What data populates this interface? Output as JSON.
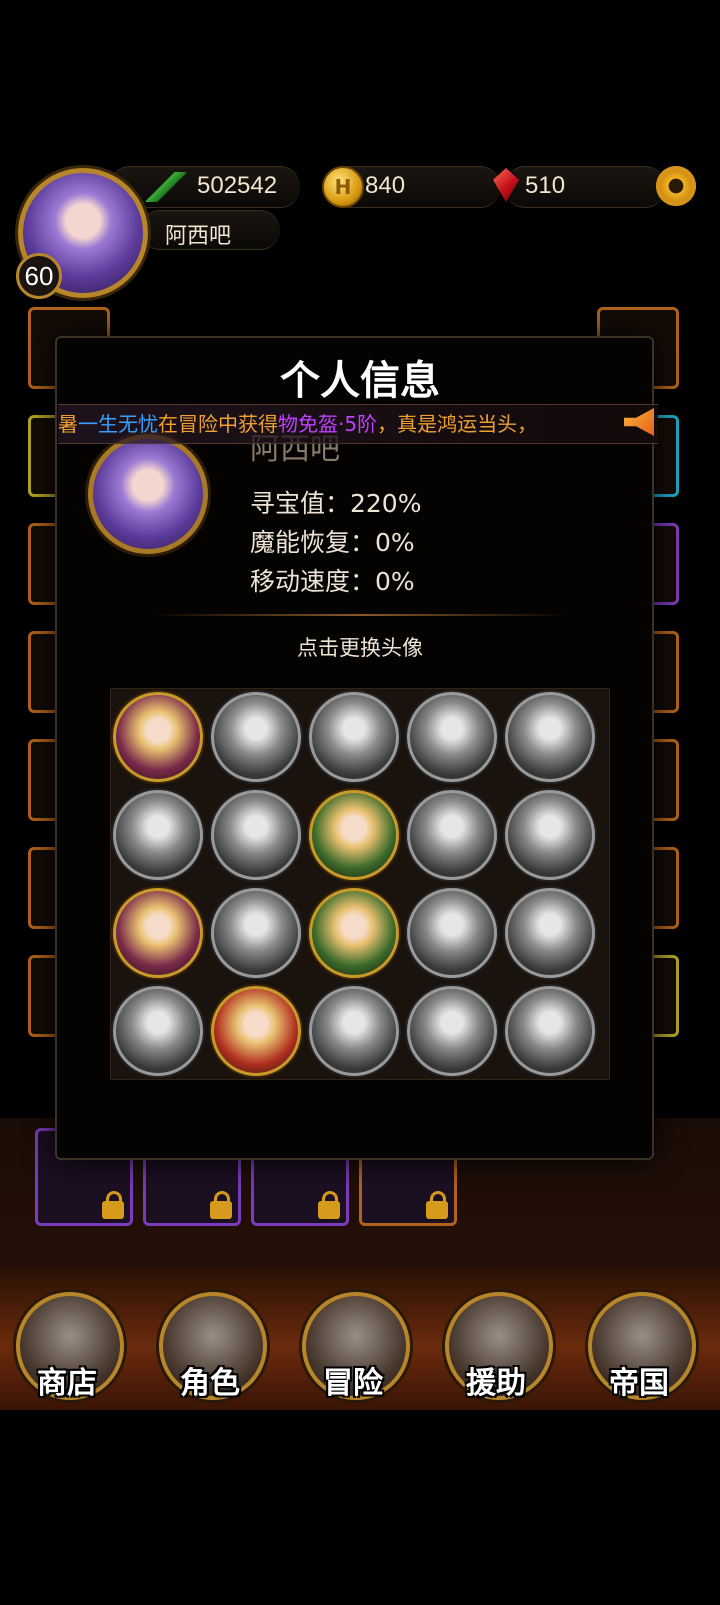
{
  "hud": {
    "power": "502542",
    "gold": "840",
    "gems": "510",
    "player_name": "阿西吧",
    "level": "60",
    "icons": {
      "power": "green-sword-icon",
      "gold": "gold-coin-icon",
      "gems": "red-gem-icon",
      "settings": "gear-icon"
    }
  },
  "modal": {
    "title": "个人信息",
    "ticker": [
      {
        "text": "暑",
        "color": "#f0a030"
      },
      {
        "text": "一生无忧",
        "color": "#3aa0ff"
      },
      {
        "text": "在冒险中获得",
        "color": "#f0a030"
      },
      {
        "text": "物免盔·5阶",
        "color": "#c040ff"
      },
      {
        "text": "，真是鸿运当头，",
        "color": "#f0a030"
      }
    ],
    "name": "阿西吧",
    "stats": [
      "寻宝值：220%",
      "魔能恢复：0%",
      "移动速度：0%"
    ],
    "hint": "点击更换头像",
    "avatars": [
      {
        "unlocked": true
      },
      {
        "unlocked": false
      },
      {
        "unlocked": false
      },
      {
        "unlocked": false
      },
      {
        "unlocked": false
      },
      {
        "unlocked": false
      },
      {
        "unlocked": false
      },
      {
        "unlocked": true
      },
      {
        "unlocked": false
      },
      {
        "unlocked": false
      },
      {
        "unlocked": true
      },
      {
        "unlocked": false
      },
      {
        "unlocked": true
      },
      {
        "unlocked": false
      },
      {
        "unlocked": false
      },
      {
        "unlocked": false
      },
      {
        "unlocked": true
      },
      {
        "unlocked": false
      },
      {
        "unlocked": false
      },
      {
        "unlocked": false
      }
    ]
  },
  "nav": [
    {
      "label": "商店",
      "icon": "castle-icon"
    },
    {
      "label": "角色",
      "icon": "hooded-figure-icon"
    },
    {
      "label": "冒险",
      "icon": "dungeon-gate-icon"
    },
    {
      "label": "援助",
      "icon": "heroine-icon"
    },
    {
      "label": "帝国",
      "icon": "crown-icon"
    }
  ],
  "colors": {
    "gold_border": "#b8862a",
    "accent_orange": "#f0a030"
  }
}
